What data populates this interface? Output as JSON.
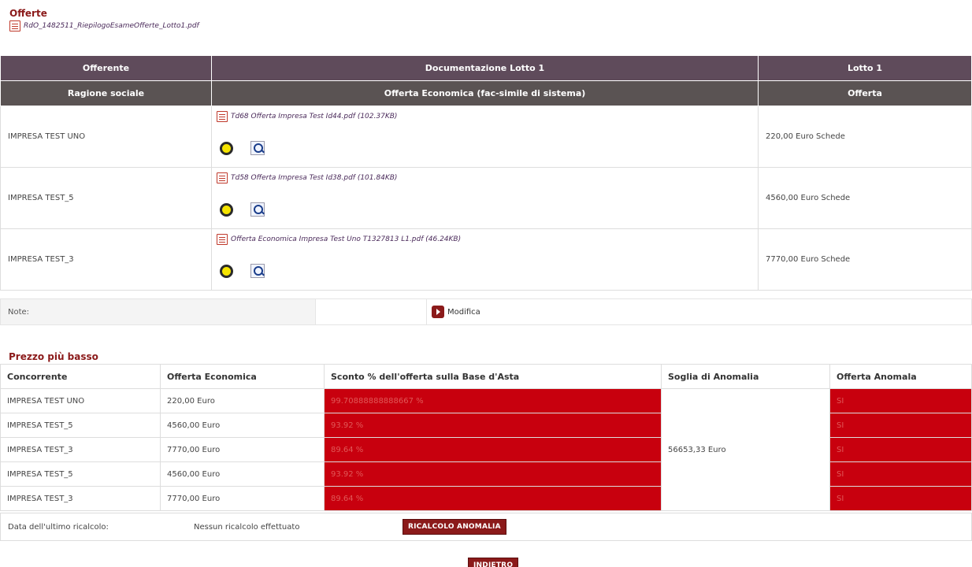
{
  "header": {
    "title": "Offerte",
    "pdf_name": "RdO_1482511_RiepilogoEsameOfferte_Lotto1.pdf"
  },
  "offerte_table": {
    "header_row1": [
      "Offerente",
      "Documentazione Lotto 1",
      "Lotto 1"
    ],
    "header_row2": [
      "Ragione sociale",
      "Offerta Economica (fac-simile di sistema)",
      "Offerta"
    ],
    "rows": [
      {
        "name": "IMPRESA TEST UNO",
        "file": "Td68 Offerta Impresa Test Id44.pdf (102.37KB)",
        "offer": "220,00 Euro Schede"
      },
      {
        "name": "IMPRESA TEST_5",
        "file": "Td58 Offerta Impresa Test Id38.pdf (101.84KB)",
        "offer": "4560,00 Euro Schede"
      },
      {
        "name": "IMPRESA TEST_3",
        "file": "Offerta Economica Impresa Test Uno T1327813 L1.pdf (46.24KB)",
        "offer": "7770,00 Euro Schede"
      }
    ]
  },
  "note": {
    "label": "Note:",
    "modify_label": "Modifica"
  },
  "prezzo": {
    "title": "Prezzo più basso",
    "headers": [
      "Concorrente",
      "Offerta Economica",
      "Sconto % dell'offerta sulla Base d'Asta",
      "Soglia di Anomalia",
      "Offerta Anomala"
    ],
    "soglia": "56653,33 Euro",
    "rows": [
      {
        "name": "IMPRESA TEST UNO",
        "offer": "220,00 Euro",
        "sconto": "99.70888888888667 %",
        "anomala": "SI"
      },
      {
        "name": "IMPRESA TEST_5",
        "offer": "4560,00 Euro",
        "sconto": "93.92 %",
        "anomala": "SI"
      },
      {
        "name": "IMPRESA TEST_3",
        "offer": "7770,00 Euro",
        "sconto": "89.64 %",
        "anomala": "SI"
      },
      {
        "name": "IMPRESA TEST_5",
        "offer": "4560,00 Euro",
        "sconto": "93.92 %",
        "anomala": "SI"
      },
      {
        "name": "IMPRESA TEST_3",
        "offer": "7770,00 Euro",
        "sconto": "89.64 %",
        "anomala": "SI"
      }
    ]
  },
  "ricalcolo": {
    "label": "Data dell'ultimo ricalcolo:",
    "value": "Nessun ricalcolo effettuato",
    "button": "RICALCOLO ANOMALIA"
  },
  "footer": {
    "back_button": "INDIETRO"
  }
}
